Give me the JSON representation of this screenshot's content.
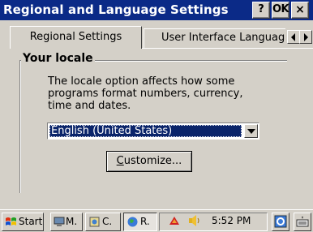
{
  "window": {
    "title": "Regional and Language Settings",
    "help_button": "?",
    "ok_button": "OK",
    "close_button": "×"
  },
  "tabs": [
    {
      "label": "Regional Settings",
      "active": true
    },
    {
      "label": "User Interface Languag",
      "active": false
    }
  ],
  "locale_group": {
    "title": "Your locale",
    "description_lines": [
      "The locale option affects how some",
      "programs format numbers, currency,",
      "time and dates."
    ],
    "selected_locale": "English (United States)",
    "customize_button": {
      "prefix": "",
      "mnemonic": "C",
      "rest": "ustomize..."
    }
  },
  "taskbar": {
    "start_label": "Start",
    "items": [
      {
        "label": "M.",
        "icon": "computer-icon"
      },
      {
        "label": "C.",
        "icon": "control-panel-icon"
      },
      {
        "label": "R.",
        "icon": "regional-settings-icon",
        "pressed": true
      }
    ],
    "tray_icons": [
      "network-icon",
      "volume-icon"
    ],
    "time": "5:52 PM",
    "desktop_icon": "desktop-icon",
    "keyboard_icon": "keyboard-icon"
  },
  "colors": {
    "title_bar": "#0b2a87",
    "face": "#d4d0c8",
    "selection": "#0a246a"
  }
}
